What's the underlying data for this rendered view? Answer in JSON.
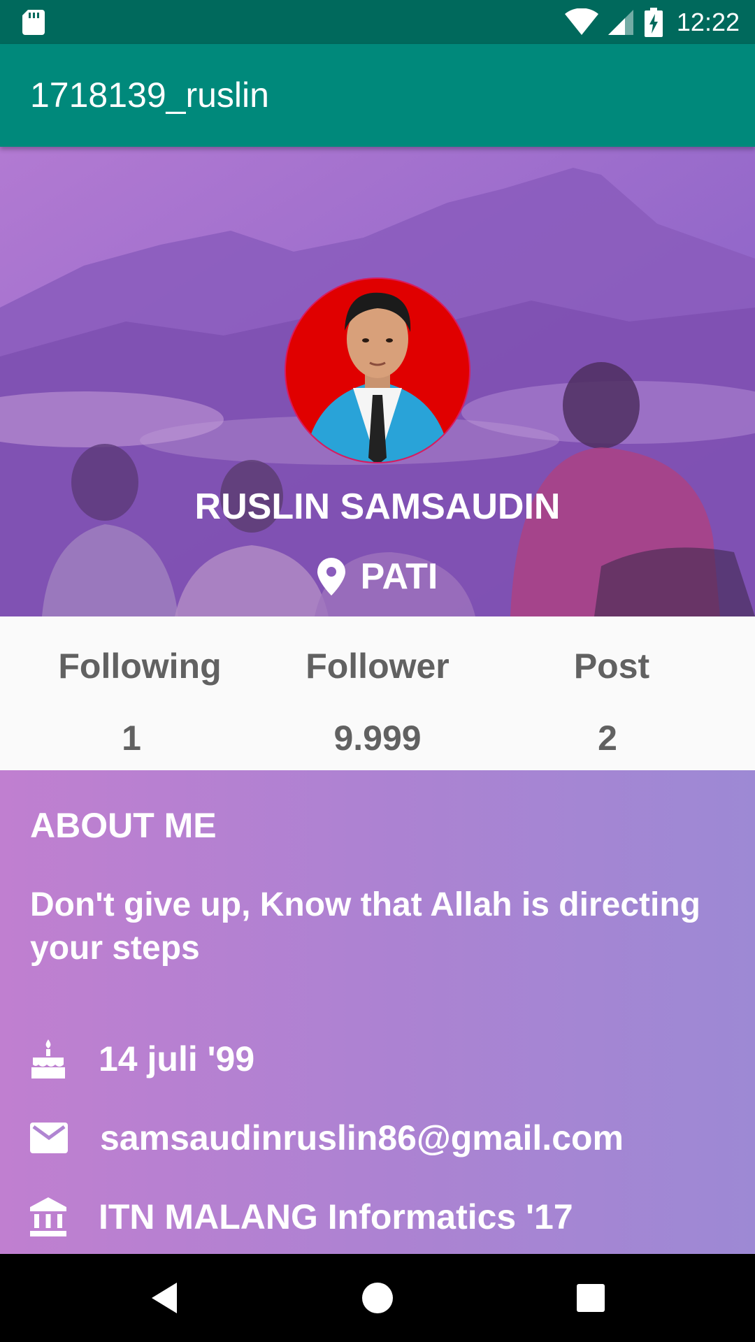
{
  "status_bar": {
    "time": "12:22"
  },
  "app_bar": {
    "title": "1718139_ruslin"
  },
  "profile": {
    "name": "RUSLIN SAMSAUDIN",
    "location": "PATI"
  },
  "stats": [
    {
      "label": "Following",
      "value": "1"
    },
    {
      "label": "Follower",
      "value": "9.999"
    },
    {
      "label": "Post",
      "value": "2"
    }
  ],
  "about": {
    "heading": "ABOUT ME",
    "quote": "Don't give up, Know that Allah is directing your steps",
    "birthday": "14 juli '99",
    "email": "samsaudinruslin86@gmail.com",
    "education": "ITN MALANG Informatics '17"
  },
  "colors": {
    "status_bar": "#00695c",
    "app_bar": "#00897b",
    "avatar_bg": "#e00000",
    "avatar_ring": "#d81b60",
    "stat_text": "#616161"
  },
  "icons": {
    "status": [
      "sd-card-icon",
      "wifi-icon",
      "signal-icon",
      "battery-charging-icon"
    ],
    "location": "location-pin-icon",
    "birthday": "cake-icon",
    "email": "email-icon",
    "education": "institution-icon",
    "nav": [
      "back-icon",
      "home-icon",
      "recents-icon"
    ]
  }
}
